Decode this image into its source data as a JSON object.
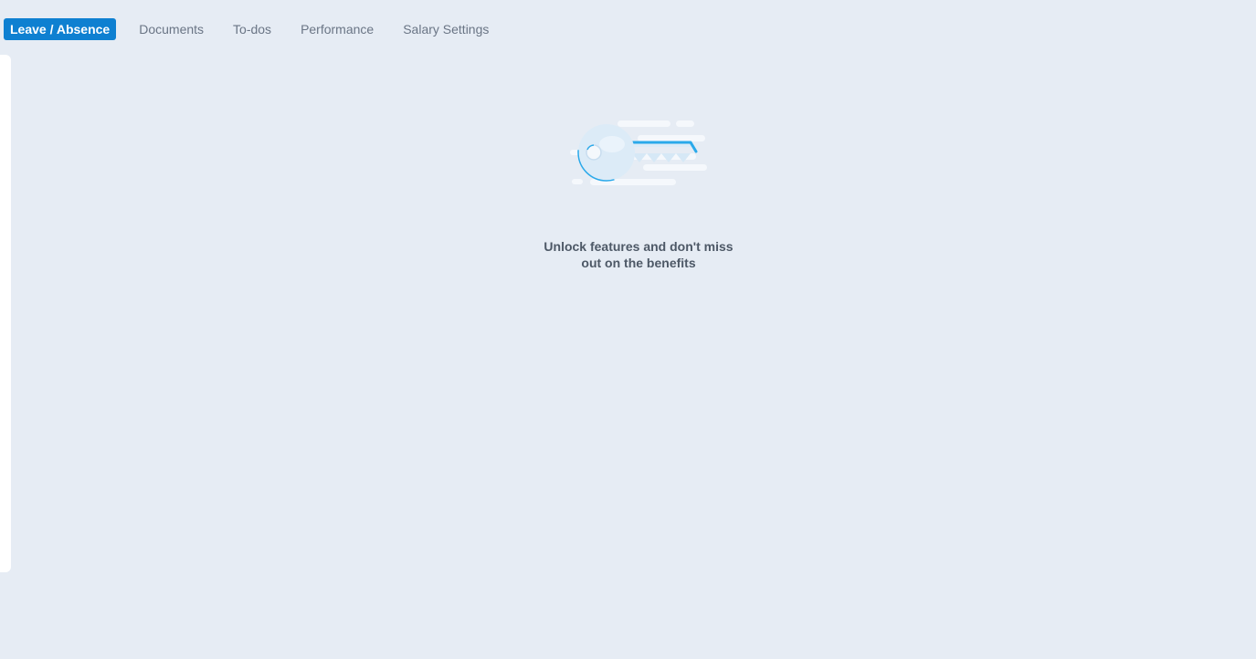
{
  "tabs": [
    {
      "label": "Leave / Absence",
      "active": true
    },
    {
      "label": "Documents",
      "active": false
    },
    {
      "label": "To-dos",
      "active": false
    },
    {
      "label": "Performance",
      "active": false
    },
    {
      "label": "Salary Settings",
      "active": false
    }
  ],
  "empty_state": {
    "icon": "key-icon",
    "line1": "Unlock features and don't miss",
    "line2": "out on the benefits"
  },
  "colors": {
    "background": "#e6ecf4",
    "accent": "#0e80d1",
    "key_blue": "#2aa9ea"
  }
}
